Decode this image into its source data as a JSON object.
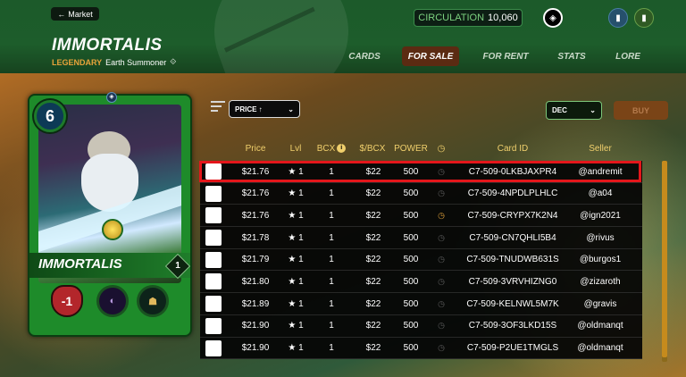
{
  "header": {
    "market_label": "Market",
    "title": "IMMORTALIS",
    "rarity": "LEGENDARY",
    "subtitle_rest": "Earth Summoner",
    "circulation_label": "CIRCULATION",
    "circulation_value": "10,060",
    "tabs": [
      {
        "label": "CARDS",
        "active": false
      },
      {
        "label": "FOR SALE",
        "active": true
      },
      {
        "label": "FOR RENT",
        "active": false
      },
      {
        "label": "STATS",
        "active": false
      },
      {
        "label": "LORE",
        "active": false
      }
    ]
  },
  "card": {
    "mana": "6",
    "name": "IMMORTALIS",
    "level": "1",
    "health": "-1",
    "element": "Earth",
    "abilities": [
      "ability-1-icon",
      "ability-2-icon"
    ]
  },
  "controls": {
    "sort_select": "PRICE ↑",
    "order_select": "DEC",
    "buy_label": "BUY"
  },
  "table": {
    "headers": [
      "Price",
      "Lvl",
      "BCX",
      "$/BCX",
      "POWER",
      "",
      "Card ID",
      "Seller"
    ],
    "rows": [
      {
        "price": "$21.76",
        "lvl": "★ 1",
        "bcx": "1",
        "per_bcx": "$22",
        "power": "500",
        "clock": "muted",
        "card_id": "C7-509-0LKBJAXPR4",
        "seller": "@andremit"
      },
      {
        "price": "$21.76",
        "lvl": "★ 1",
        "bcx": "1",
        "per_bcx": "$22",
        "power": "500",
        "clock": "muted",
        "card_id": "C7-509-4NPDLPLHLC",
        "seller": "@a04"
      },
      {
        "price": "$21.76",
        "lvl": "★ 1",
        "bcx": "1",
        "per_bcx": "$22",
        "power": "500",
        "clock": "on",
        "card_id": "C7-509-CRYPX7K2N4",
        "seller": "@ign2021"
      },
      {
        "price": "$21.78",
        "lvl": "★ 1",
        "bcx": "1",
        "per_bcx": "$22",
        "power": "500",
        "clock": "muted",
        "card_id": "C7-509-CN7QHLI5B4",
        "seller": "@rivus"
      },
      {
        "price": "$21.79",
        "lvl": "★ 1",
        "bcx": "1",
        "per_bcx": "$22",
        "power": "500",
        "clock": "muted",
        "card_id": "C7-509-TNUDWB631S",
        "seller": "@burgos1"
      },
      {
        "price": "$21.80",
        "lvl": "★ 1",
        "bcx": "1",
        "per_bcx": "$22",
        "power": "500",
        "clock": "muted",
        "card_id": "C7-509-3VRVHIZNG0",
        "seller": "@zizaroth"
      },
      {
        "price": "$21.89",
        "lvl": "★ 1",
        "bcx": "1",
        "per_bcx": "$22",
        "power": "500",
        "clock": "muted",
        "card_id": "C7-509-KELNWL5M7K",
        "seller": "@gravis"
      },
      {
        "price": "$21.90",
        "lvl": "★ 1",
        "bcx": "1",
        "per_bcx": "$22",
        "power": "500",
        "clock": "muted",
        "card_id": "C7-509-3OF3LKD15S",
        "seller": "@oldmanqt"
      },
      {
        "price": "$21.90",
        "lvl": "★ 1",
        "bcx": "1",
        "per_bcx": "$22",
        "power": "500",
        "clock": "muted",
        "card_id": "C7-509-P2UE1TMGLS",
        "seller": "@oldmanqt"
      }
    ]
  },
  "colors": {
    "header_accent": "#7cd17f",
    "rarity": "#e8a33a",
    "active_tab": "#5b2b12",
    "table_header": "#f0cf6c",
    "highlight": "#e4161b"
  }
}
